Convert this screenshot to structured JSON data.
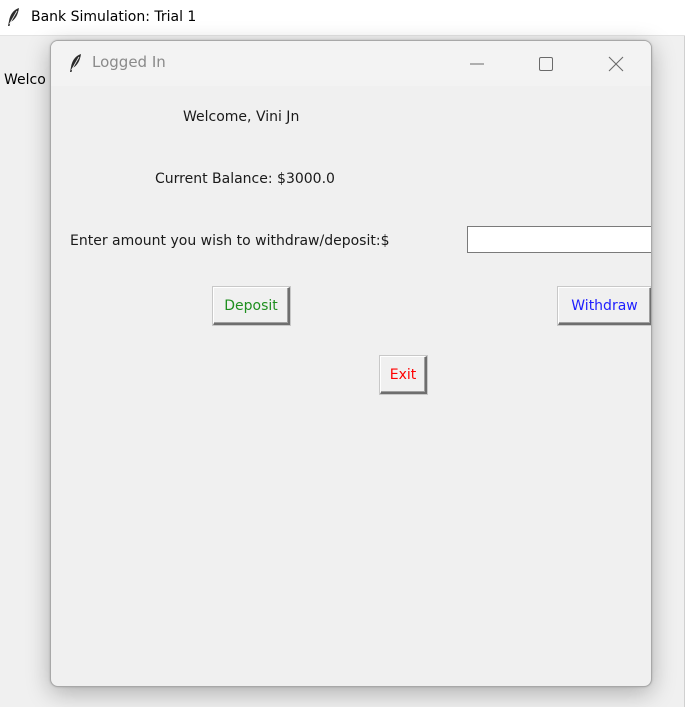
{
  "main_window": {
    "title": "Bank Simulation: Trial 1",
    "body_text": "Welco"
  },
  "dialog": {
    "title": "Logged In",
    "welcome": "Welcome, Vini Jn",
    "balance": "Current Balance: $3000.0",
    "amount_prompt": "Enter amount you wish to withdraw/deposit:$",
    "amount_value": "",
    "buttons": {
      "deposit": "Deposit",
      "withdraw": "Withdraw",
      "exit": "Exit"
    }
  },
  "colors": {
    "deposit_text": "#1f8f1f",
    "withdraw_text": "#1e1eff",
    "exit_text": "#ff0000"
  },
  "icons": {
    "app_icon": "feather-icon",
    "minimize": "minimize-icon",
    "maximize": "maximize-icon",
    "close": "close-icon"
  }
}
